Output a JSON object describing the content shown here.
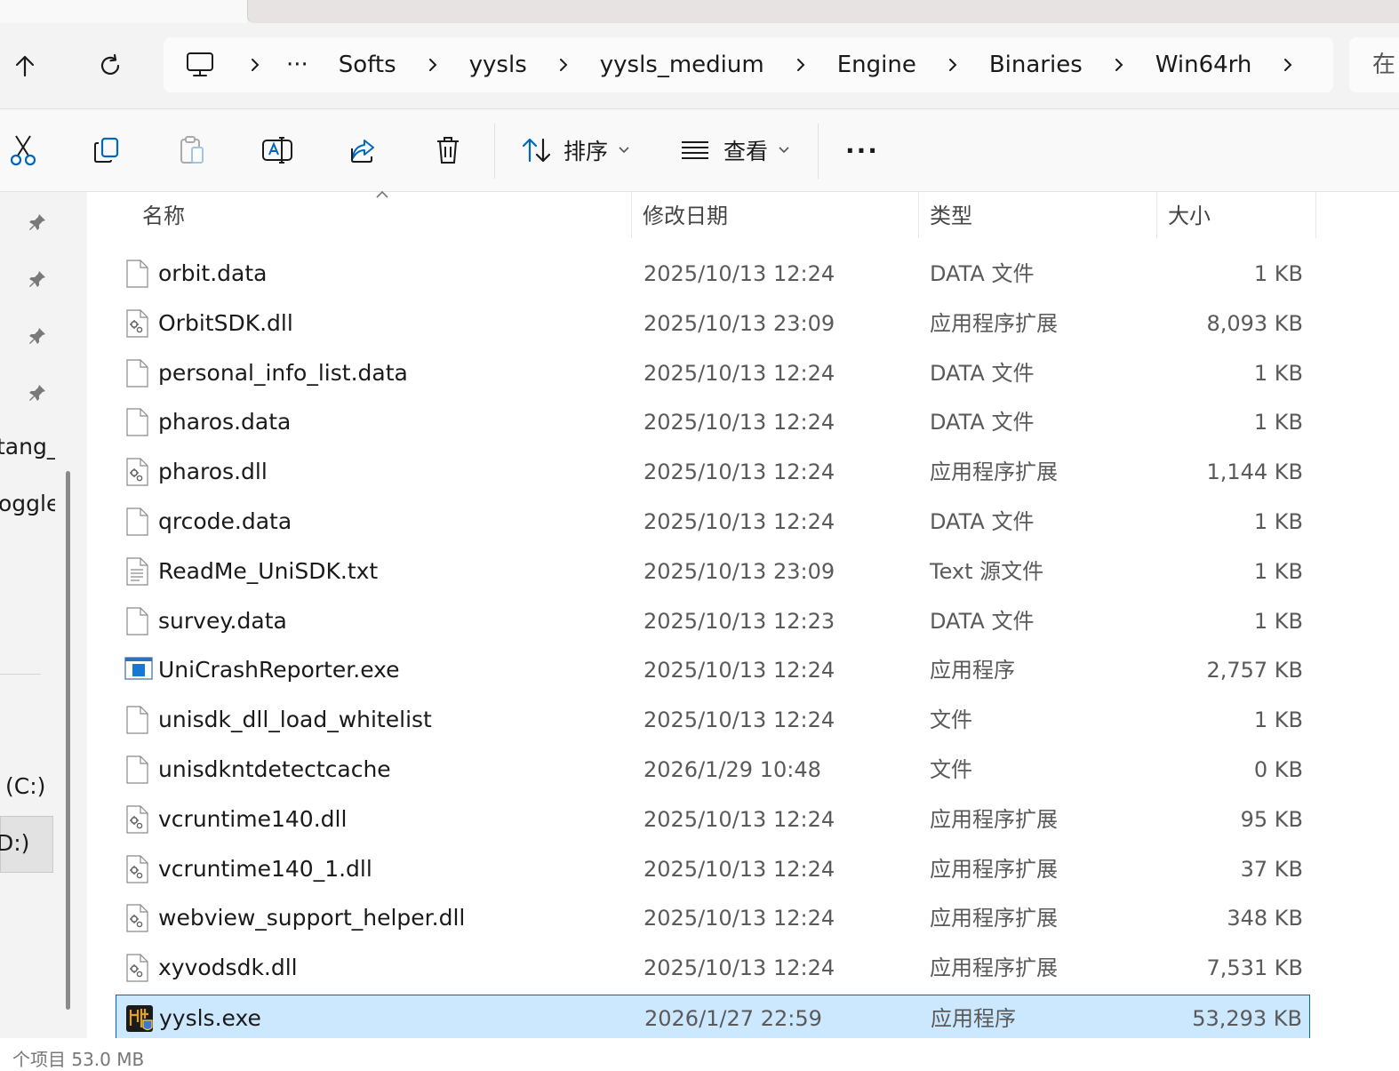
{
  "breadcrumb": {
    "more_label": "···",
    "items": [
      "Softs",
      "yysls",
      "yysls_medium",
      "Engine",
      "Binaries",
      "Win64rh"
    ]
  },
  "search": {
    "placeholder": "在"
  },
  "toolbar": {
    "sort_label": "排序",
    "view_label": "查看",
    "more_label": "···"
  },
  "nav": {
    "items": [
      "tang_",
      "oggle",
      "(C:)",
      "D:)"
    ]
  },
  "columns": {
    "name": "名称",
    "date": "修改日期",
    "type": "类型",
    "size": "大小"
  },
  "files": [
    {
      "name": "orbit.data",
      "date": "2025/10/13 12:24",
      "type": "DATA 文件",
      "size": "1 KB",
      "icon": "blank-file-icon"
    },
    {
      "name": "OrbitSDK.dll",
      "date": "2025/10/13 23:09",
      "type": "应用程序扩展",
      "size": "8,093 KB",
      "icon": "dll-file-icon"
    },
    {
      "name": "personal_info_list.data",
      "date": "2025/10/13 12:24",
      "type": "DATA 文件",
      "size": "1 KB",
      "icon": "blank-file-icon"
    },
    {
      "name": "pharos.data",
      "date": "2025/10/13 12:24",
      "type": "DATA 文件",
      "size": "1 KB",
      "icon": "blank-file-icon"
    },
    {
      "name": "pharos.dll",
      "date": "2025/10/13 12:24",
      "type": "应用程序扩展",
      "size": "1,144 KB",
      "icon": "dll-file-icon"
    },
    {
      "name": "qrcode.data",
      "date": "2025/10/13 12:24",
      "type": "DATA 文件",
      "size": "1 KB",
      "icon": "blank-file-icon"
    },
    {
      "name": "ReadMe_UniSDK.txt",
      "date": "2025/10/13 23:09",
      "type": "Text 源文件",
      "size": "1 KB",
      "icon": "text-file-icon"
    },
    {
      "name": "survey.data",
      "date": "2025/10/13 12:23",
      "type": "DATA 文件",
      "size": "1 KB",
      "icon": "blank-file-icon"
    },
    {
      "name": "UniCrashReporter.exe",
      "date": "2025/10/13 12:24",
      "type": "应用程序",
      "size": "2,757 KB",
      "icon": "exe-window-icon"
    },
    {
      "name": "unisdk_dll_load_whitelist",
      "date": "2025/10/13 12:24",
      "type": "文件",
      "size": "1 KB",
      "icon": "blank-file-icon"
    },
    {
      "name": "unisdkntdetectcache",
      "date": "2026/1/29 10:48",
      "type": "文件",
      "size": "0 KB",
      "icon": "blank-file-icon"
    },
    {
      "name": "vcruntime140.dll",
      "date": "2025/10/13 12:24",
      "type": "应用程序扩展",
      "size": "95 KB",
      "icon": "dll-file-icon"
    },
    {
      "name": "vcruntime140_1.dll",
      "date": "2025/10/13 12:24",
      "type": "应用程序扩展",
      "size": "37 KB",
      "icon": "dll-file-icon"
    },
    {
      "name": "webview_support_helper.dll",
      "date": "2025/10/13 12:24",
      "type": "应用程序扩展",
      "size": "348 KB",
      "icon": "dll-file-icon"
    },
    {
      "name": "xyvodsdk.dll",
      "date": "2025/10/13 12:24",
      "type": "应用程序扩展",
      "size": "7,531 KB",
      "icon": "dll-file-icon"
    },
    {
      "name": "yysls.exe",
      "date": "2026/1/27 22:59",
      "type": "应用程序",
      "size": "53,293 KB",
      "icon": "game-app-icon",
      "selected": true
    }
  ],
  "status": {
    "text": "个项目  53.0 MB"
  },
  "colors": {
    "selection": "#cce8ff",
    "selection_border": "#0067c0",
    "accent": "#0067c0"
  }
}
